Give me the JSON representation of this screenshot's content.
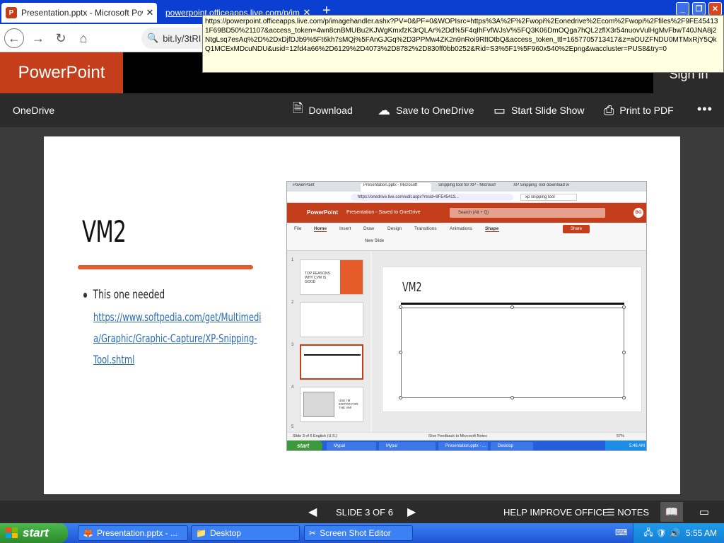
{
  "browser": {
    "tabs": [
      {
        "title": "Presentation.pptx - Microsoft PowerPoint Online",
        "active": true
      },
      {
        "title": "powerpoint.officeapps.live.com/p/imagehandler.ashx",
        "active": false
      }
    ],
    "address": "bit.ly/3tRI",
    "tooltip_url": "https://powerpoint.officeapps.live.com/p/imagehandler.ashx?PV=0&PF=0&WOPIsrc=https%3A%2F%2Fwopi%2Eonedrive%2Ecom%2Fwopi%2Ffiles%2F9FE454131F69BD50%21107&access_token=4wn8cnBMUBu2KJWgKmxfzK3rQLAr%2Dd%5F4qIhFvfWJsV%5FQ3K06DmOQga7hQL2zflX3r54nuovVulHgMvFbwT40JNA8j2NtgLsq7esAq%2D%2DxDjfDJb9%5Ft6kh7sMQj%5FAnGJGq%2D3PPMw4ZK2n9nRoi9RttOtbQ&access_token_ttl=1657705713417&z=aOUZFNDU0MTMxRjY5QkQ1MCExMDcuNDU&usid=12fd4a66%2D6129%2D4073%2D8782%2D830ff0bb0252&Rid=S3%5F1%5F960x540%2Epng&waccluster=PUS8&try=0"
  },
  "app": {
    "brand": "PowerPoint",
    "signin": "Sign in",
    "onedrive": "OneDrive",
    "commands": {
      "download": "Download",
      "save": "Save to OneDrive",
      "slideshow": "Start Slide Show",
      "print": "Print to PDF",
      "more": "•••"
    }
  },
  "slide": {
    "title": "VM2",
    "bullet": "This one needed",
    "link_lines": [
      "https://www.softpedia.com/get/Multimedi",
      "a/Graphic/Graphic-Capture/XP-Snipping-",
      "Tool.shtml"
    ]
  },
  "screenshot": {
    "tabs": [
      "PowerPoint",
      "Presentation.pptx - Microsoft",
      "Snipping tool for XP - Microsof",
      "XP Snipping Tool download w"
    ],
    "url": "https://onedrive.live.com/edit.aspx?resid=9FE45413...",
    "search_tab": "xp snipping tool",
    "app_name": "PowerPoint",
    "doc_name": "Presentation  -  Saved to OneDrive",
    "search": "Search (Alt + Q)",
    "avatar": "BG",
    "ribbon_tabs": [
      "File",
      "Home",
      "Insert",
      "Draw",
      "Design",
      "Transitions",
      "Animations",
      "Shape"
    ],
    "share": "Share",
    "new_slide": "New Slide",
    "thumb1_text": "TOP REASONS WHY CVM IS GOOD",
    "thumb4_text": "USE I'M EDITOR FOR THE VM!",
    "slide_numbers": [
      "1",
      "2",
      "3",
      "4",
      "5"
    ],
    "slide_title": "VM2",
    "status_left": "Slide 3 of 6     English (U.S.)",
    "status_right": "Give Feedback to Microsoft     Notes",
    "zoom": "57%",
    "taskbar_start": "start",
    "taskbar_items": [
      "Mypal",
      "Mypal",
      "Presentation.pptx - ...",
      "Desktop"
    ],
    "time": "5:46 AM"
  },
  "bottom": {
    "slide_label": "SLIDE 3 OF 6",
    "help": "HELP IMPROVE OFFICE",
    "notes": "NOTES"
  },
  "taskbar": {
    "start": "start",
    "items": [
      "Presentation.pptx - ...",
      "Desktop",
      "Screen Shot Editor"
    ],
    "time": "5:55 AM"
  },
  "colors": {
    "accent": "#c43e1c",
    "xp_blue": "#245edb",
    "link": "#2a6bb5",
    "slide_underline": "#e55b2a"
  }
}
